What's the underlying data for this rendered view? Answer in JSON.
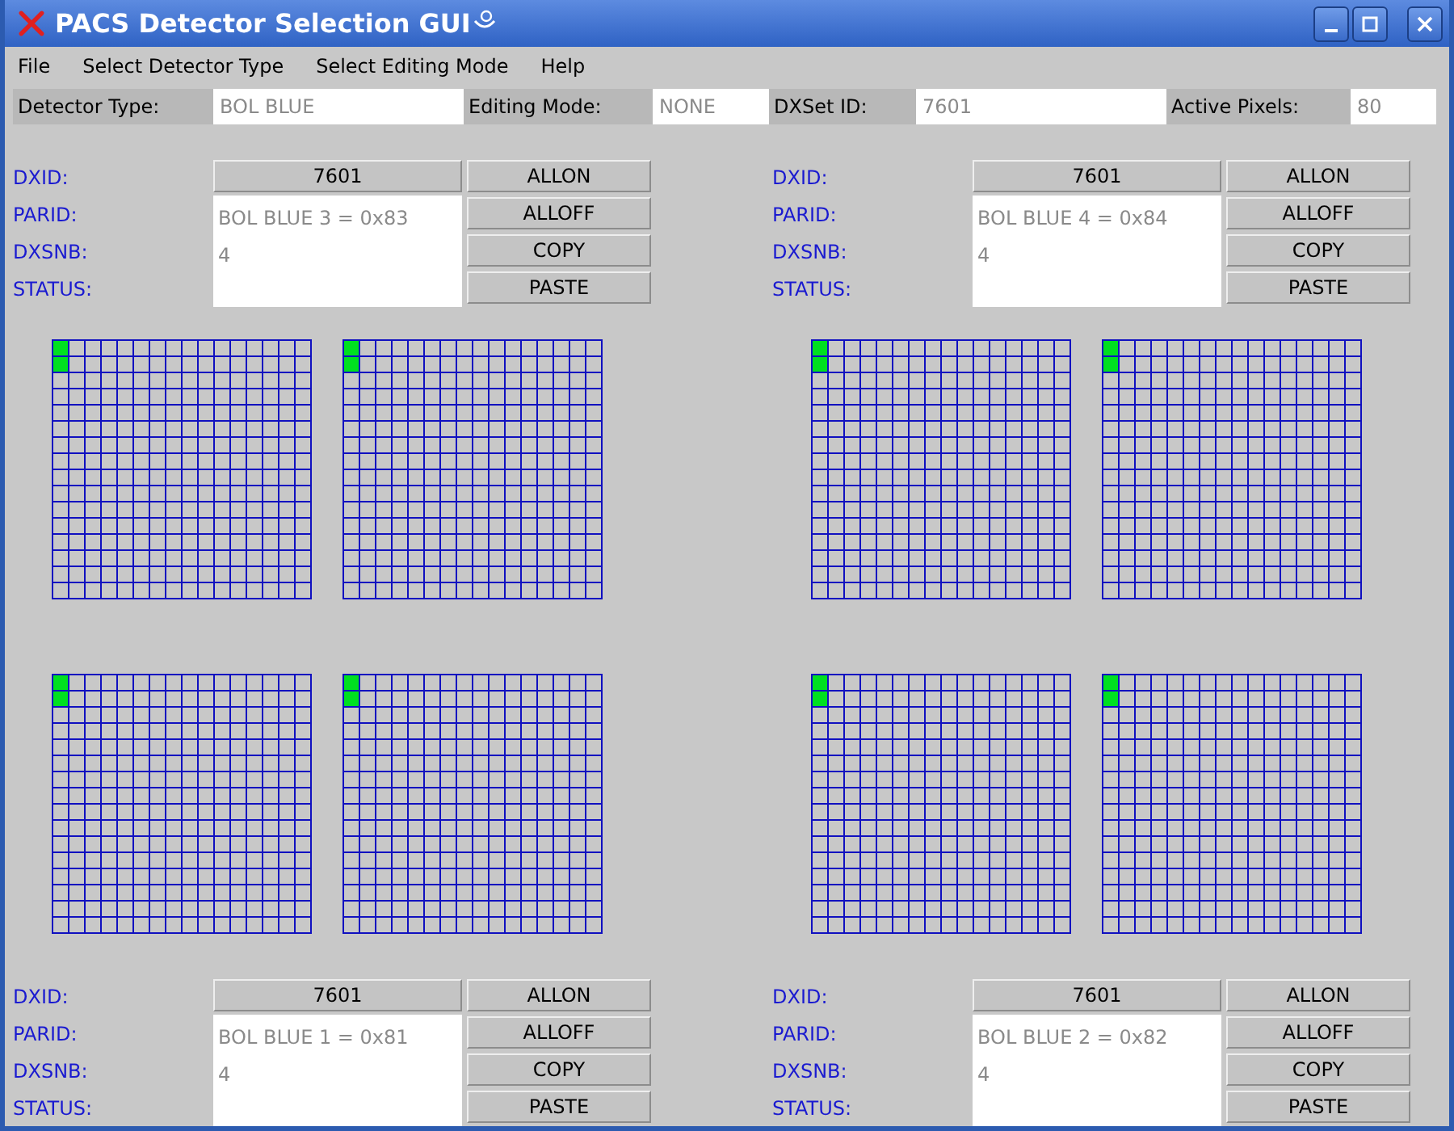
{
  "window": {
    "title": "PACS Detector Selection GUI"
  },
  "menu": [
    "File",
    "Select Detector Type",
    "Select Editing Mode",
    "Help"
  ],
  "info": [
    {
      "label": "Detector Type:",
      "value": "BOL BLUE"
    },
    {
      "label": "Editing Mode:",
      "value": "NONE"
    },
    {
      "label": "DXSet ID:",
      "value": "7601"
    },
    {
      "label": "Active Pixels:",
      "value": "80"
    }
  ],
  "quadrants": [
    {
      "kind": "panel_above",
      "panel": {
        "dxid_label": "DXID:",
        "dxid": "7601",
        "parid_label": "PARID:",
        "parid": "BOL BLUE 3 = 0x83",
        "dxsnb_label": "DXSNB:",
        "dxsnb": "4",
        "status_label": "STATUS:",
        "buttons": [
          "ALLON",
          "ALLOFF",
          "COPY",
          "PASTE"
        ]
      },
      "matrices": [
        {
          "active": [
            [
              true,
              false,
              false,
              false,
              false,
              false,
              false,
              false,
              false,
              false,
              false,
              false,
              false,
              false,
              false,
              false
            ],
            [
              true,
              false,
              false,
              false,
              false,
              false,
              false,
              false,
              false,
              false,
              false,
              false,
              false,
              false,
              false,
              false
            ]
          ]
        },
        {
          "active": [
            [
              true,
              false,
              false,
              false,
              false,
              false,
              false,
              false,
              false,
              false,
              false,
              false,
              false,
              false,
              false,
              false
            ],
            [
              true,
              false,
              false,
              false,
              false,
              false,
              false,
              false,
              false,
              false,
              false,
              false,
              false,
              false,
              false,
              false
            ]
          ]
        }
      ]
    },
    {
      "kind": "panel_above",
      "panel": {
        "dxid_label": "DXID:",
        "dxid": "7601",
        "parid_label": "PARID:",
        "parid": "BOL BLUE 4 = 0x84",
        "dxsnb_label": "DXSNB:",
        "dxsnb": "4",
        "status_label": "STATUS:",
        "buttons": [
          "ALLON",
          "ALLOFF",
          "COPY",
          "PASTE"
        ]
      },
      "matrices": [
        {
          "active": [
            [
              true,
              false,
              false,
              false,
              false,
              false,
              false,
              false,
              false,
              false,
              false,
              false,
              false,
              false,
              false,
              false
            ],
            [
              true,
              false,
              false,
              false,
              false,
              false,
              false,
              false,
              false,
              false,
              false,
              false,
              false,
              false,
              false,
              false
            ]
          ]
        },
        {
          "active": [
            [
              true,
              false,
              false,
              false,
              false,
              false,
              false,
              false,
              false,
              false,
              false,
              false,
              false,
              false,
              false,
              false
            ],
            [
              true,
              false,
              false,
              false,
              false,
              false,
              false,
              false,
              false,
              false,
              false,
              false,
              false,
              false,
              false,
              false
            ]
          ]
        }
      ]
    },
    {
      "kind": "panel_below",
      "panel": {
        "dxid_label": "DXID:",
        "dxid": "7601",
        "parid_label": "PARID:",
        "parid": "BOL BLUE 1 = 0x81",
        "dxsnb_label": "DXSNB:",
        "dxsnb": "4",
        "status_label": "STATUS:",
        "buttons": [
          "ALLON",
          "ALLOFF",
          "COPY",
          "PASTE"
        ]
      },
      "matrices": [
        {
          "active": [
            [
              true,
              false,
              false,
              false,
              false,
              false,
              false,
              false,
              false,
              false,
              false,
              false,
              false,
              false,
              false,
              false
            ],
            [
              true,
              false,
              false,
              false,
              false,
              false,
              false,
              false,
              false,
              false,
              false,
              false,
              false,
              false,
              false,
              false
            ]
          ]
        },
        {
          "active": [
            [
              true,
              false,
              false,
              false,
              false,
              false,
              false,
              false,
              false,
              false,
              false,
              false,
              false,
              false,
              false,
              false
            ],
            [
              true,
              false,
              false,
              false,
              false,
              false,
              false,
              false,
              false,
              false,
              false,
              false,
              false,
              false,
              false,
              false
            ]
          ]
        }
      ]
    },
    {
      "kind": "panel_below",
      "panel": {
        "dxid_label": "DXID:",
        "dxid": "7601",
        "parid_label": "PARID:",
        "parid": "BOL BLUE 2 = 0x82",
        "dxsnb_label": "DXSNB:",
        "dxsnb": "4",
        "status_label": "STATUS:",
        "buttons": [
          "ALLON",
          "ALLOFF",
          "COPY",
          "PASTE"
        ]
      },
      "matrices": [
        {
          "active": [
            [
              true,
              false,
              false,
              false,
              false,
              false,
              false,
              false,
              false,
              false,
              false,
              false,
              false,
              false,
              false,
              false
            ],
            [
              true,
              false,
              false,
              false,
              false,
              false,
              false,
              false,
              false,
              false,
              false,
              false,
              false,
              false,
              false,
              false
            ]
          ]
        },
        {
          "active": [
            [
              true,
              false,
              false,
              false,
              false,
              false,
              false,
              false,
              false,
              false,
              false,
              false,
              false,
              false,
              false,
              false
            ],
            [
              true,
              false,
              false,
              false,
              false,
              false,
              false,
              false,
              false,
              false,
              false,
              false,
              false,
              false,
              false,
              false
            ]
          ]
        }
      ]
    }
  ]
}
